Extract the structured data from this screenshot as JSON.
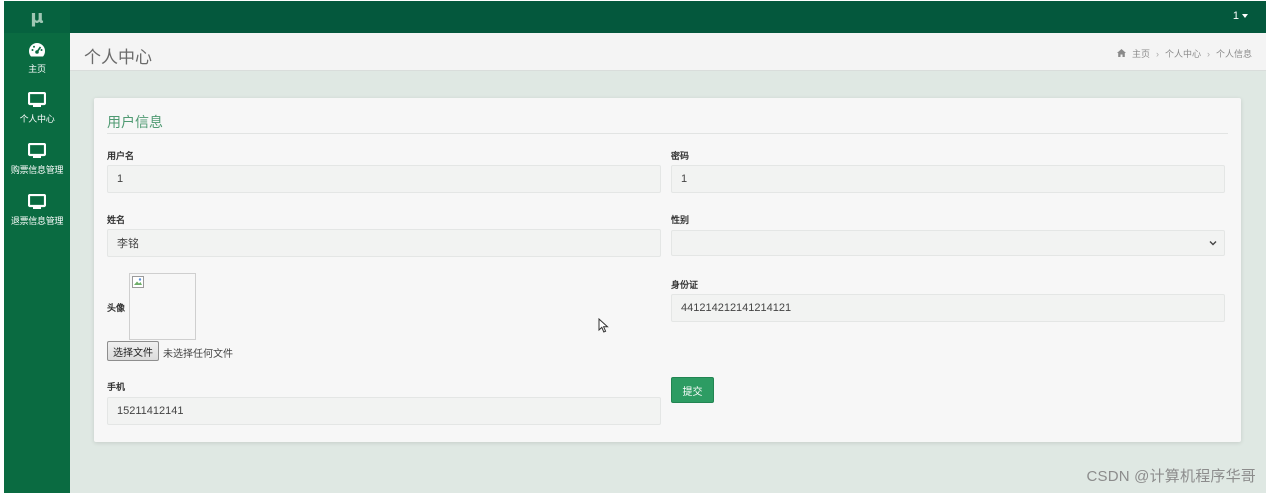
{
  "app": {
    "logo_text": "μ",
    "user_label": "1"
  },
  "sidebar": {
    "items": [
      {
        "label": "主页",
        "icon": "dashboard-icon"
      },
      {
        "label": "个人中心",
        "icon": "monitor-icon"
      },
      {
        "label": "购票信息管理",
        "icon": "monitor-icon"
      },
      {
        "label": "退票信息管理",
        "icon": "monitor-icon"
      }
    ]
  },
  "page": {
    "title": "个人中心",
    "breadcrumb": [
      "主页",
      "个人中心",
      "个人信息"
    ]
  },
  "form": {
    "title": "用户信息",
    "username": {
      "label": "用户名",
      "value": "1"
    },
    "password": {
      "label": "密码",
      "value": "1"
    },
    "name": {
      "label": "姓名",
      "value": "李铭"
    },
    "gender": {
      "label": "性别",
      "value": ""
    },
    "avatar": {
      "label": "头像",
      "file_button": "选择文件",
      "file_status": "未选择任何文件"
    },
    "id_card": {
      "label": "身份证",
      "value": "441214212141214121"
    },
    "phone": {
      "label": "手机",
      "value": "15211412141"
    },
    "submit_label": "提交"
  },
  "colors": {
    "topbar": "#04583d",
    "sidebar": "#0a6b41",
    "accent": "#2d9c63",
    "card_title": "#4f9a72"
  },
  "watermark": "CSDN @计算机程序华哥"
}
